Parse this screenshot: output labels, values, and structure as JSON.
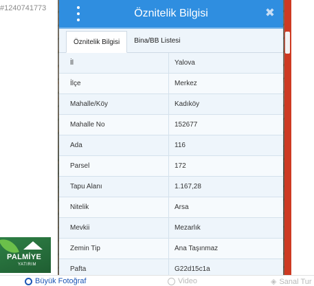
{
  "listing_id": "#1240741773",
  "dialog": {
    "title": "Öznitelik Bilgisi",
    "tabs": [
      {
        "label": "Öznitelik Bilgisi",
        "active": true
      },
      {
        "label": "Bina/BB Listesi",
        "active": false
      }
    ],
    "rows": [
      {
        "key": "İl",
        "value": "Yalova"
      },
      {
        "key": "İlçe",
        "value": "Merkez"
      },
      {
        "key": "Mahalle/Köy",
        "value": "Kadıköy"
      },
      {
        "key": "Mahalle No",
        "value": "152677"
      },
      {
        "key": "Ada",
        "value": "116"
      },
      {
        "key": "Parsel",
        "value": "172"
      },
      {
        "key": "Tapu Alanı",
        "value": "1.167,28"
      },
      {
        "key": "Nitelik",
        "value": "Arsa"
      },
      {
        "key": "Mevkii",
        "value": "Mezarlık"
      },
      {
        "key": "Zemin Tip",
        "value": "Ana Taşınmaz"
      },
      {
        "key": "Pafta",
        "value": "G22d15c1a"
      }
    ]
  },
  "logo": {
    "brand": "PALMİYE",
    "sub": "YATIRIM"
  },
  "bottom_bar": {
    "big_photo": "Büyük Fotoğraf",
    "video": "Video",
    "virtual_tour": "Sanal Tur"
  },
  "colors": {
    "header": "#2f8ee0",
    "accent_strip": "#cd3a22",
    "link": "#1b55b5"
  }
}
